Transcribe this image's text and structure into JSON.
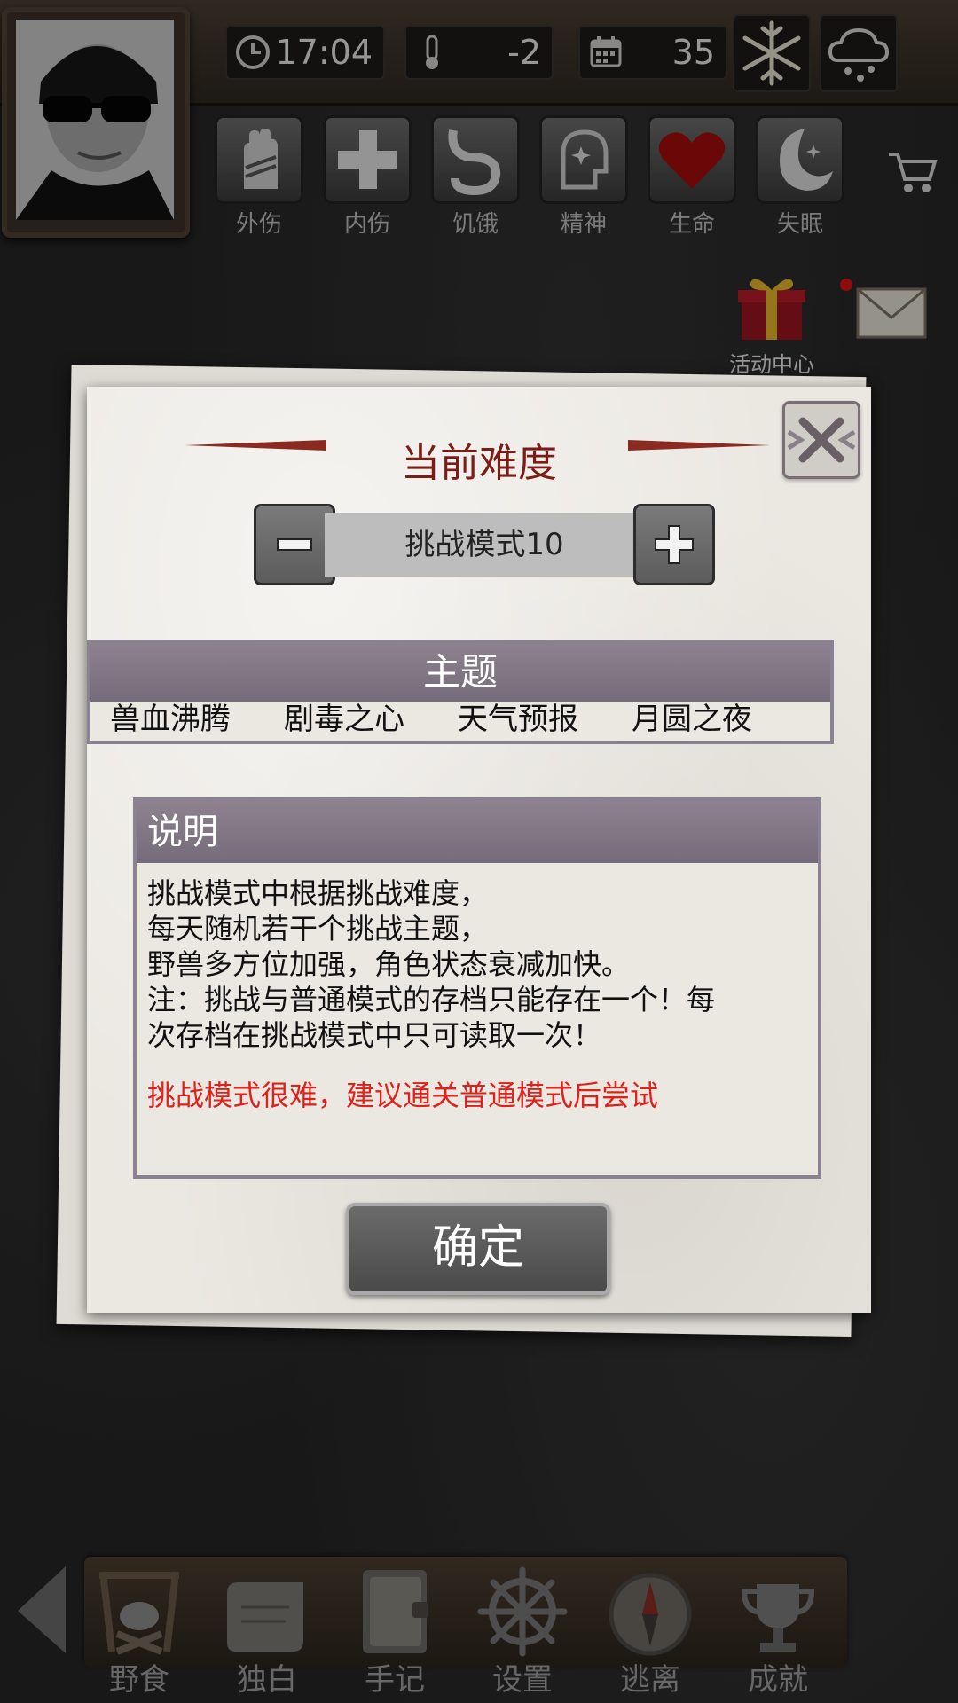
{
  "hud": {
    "time": "17:04",
    "temperature": "-2",
    "day": "35",
    "status_labels": [
      "外伤",
      "内伤",
      "饥饿",
      "精神",
      "生命",
      "失眠"
    ],
    "event_center_label": "活动中心"
  },
  "dialog": {
    "title": "当前难度",
    "difficulty_value": "挑战模式10",
    "theme_header": "主题",
    "themes": [
      "兽血沸腾",
      "剧毒之心",
      "天气预报",
      "月圆之夜"
    ],
    "desc_header": "说明",
    "desc_lines": [
      "挑战模式中根据挑战难度，",
      "每天随机若干个挑战主题，",
      "野兽多方位加强，角色状态衰减加快。",
      "注：挑战与普通模式的存档只能存在一个！每",
      "次存档在挑战模式中只可读取一次！"
    ],
    "warning": "挑战模式很难，建议通关普通模式后尝试",
    "confirm_label": "确定"
  },
  "bottom_nav": {
    "items": [
      "野食",
      "独白",
      "手记",
      "设置",
      "逃离",
      "成就"
    ]
  },
  "colors": {
    "title_red": "#7a1d16",
    "warning_red": "#e0201b",
    "panel_header": "#8e8290",
    "paper": "#ebe8e2"
  }
}
